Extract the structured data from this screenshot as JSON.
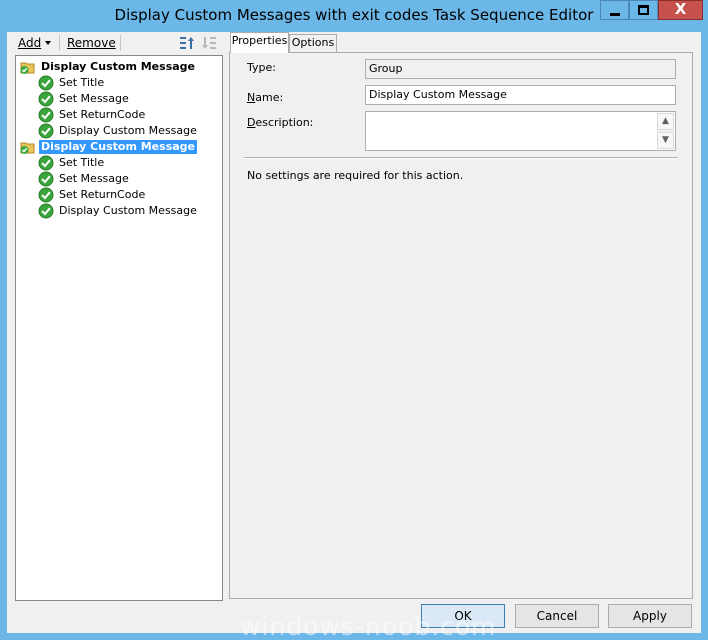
{
  "window": {
    "title": "Display Custom Messages with exit codes Task Sequence Editor",
    "controls": {
      "minimize": "minimize",
      "maximize": "maximize",
      "close": "X"
    }
  },
  "toolbar": {
    "add_label": "Add",
    "remove_label": "Remove"
  },
  "tree": {
    "items": [
      {
        "label": "Display Custom Message",
        "type": "group",
        "level": 0,
        "bold": true,
        "selected": false
      },
      {
        "label": "Set Title",
        "type": "step",
        "level": 1
      },
      {
        "label": "Set Message",
        "type": "step",
        "level": 1
      },
      {
        "label": "Set ReturnCode",
        "type": "step",
        "level": 1
      },
      {
        "label": "Display Custom Message",
        "type": "step",
        "level": 1
      },
      {
        "label": "Display Custom Message",
        "type": "group",
        "level": 0,
        "bold": true,
        "selected": true
      },
      {
        "label": "Set Title",
        "type": "step",
        "level": 1
      },
      {
        "label": "Set Message",
        "type": "step",
        "level": 1
      },
      {
        "label": "Set ReturnCode",
        "type": "step",
        "level": 1
      },
      {
        "label": "Display Custom Message",
        "type": "step",
        "level": 1
      }
    ]
  },
  "tabs": [
    {
      "label": "Properties",
      "active": true
    },
    {
      "label": "Options",
      "active": false
    }
  ],
  "properties": {
    "type_label": "Type:",
    "type_value": "Group",
    "name_label": "Name:",
    "name_value": "Display Custom Message",
    "description_label": "Description:",
    "description_value": "",
    "info_text": "No settings are required  for this action."
  },
  "buttons": {
    "ok": "OK",
    "cancel": "Cancel",
    "apply": "Apply"
  },
  "watermark": "windows-noob.com",
  "colors": {
    "window_frame": "#6bb7e7",
    "close_button": "#c7514c",
    "selection": "#3399ff",
    "checkmark_green": "#3aa53a",
    "folder_yellow": "#e8c45a"
  },
  "icons": {
    "group": "folder-check-icon",
    "step": "green-check-icon",
    "move_up": "move-up-icon",
    "move_down": "move-down-icon"
  }
}
